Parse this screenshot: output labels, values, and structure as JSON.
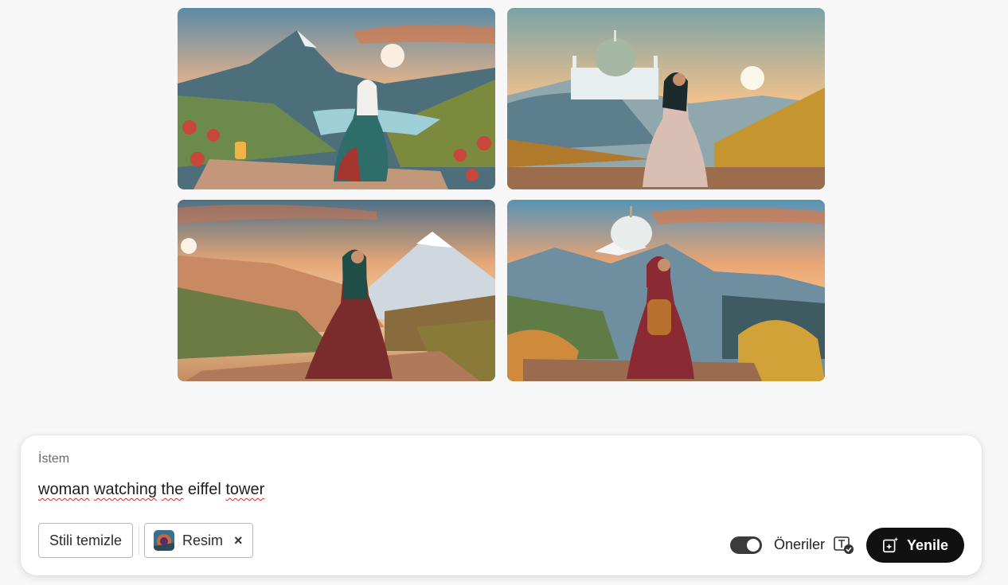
{
  "gallery": {
    "images": [
      {
        "icon": "mountain-woman-lantern-image"
      },
      {
        "icon": "mosque-woman-hills-image"
      },
      {
        "icon": "snow-mountain-woman-image"
      },
      {
        "icon": "dome-mountain-woman-backpack-image"
      }
    ]
  },
  "prompt_panel": {
    "label": "İstem",
    "prompt_words": [
      "woman",
      "watching",
      "the",
      "eiffel",
      "tower"
    ],
    "clear_style_label": "Stili temizle",
    "reference_chip_label": "Resim",
    "remove_icon": "×",
    "suggestions_label": "Öneriler",
    "suggestions_enabled": true,
    "refresh_label": "Yenile"
  }
}
